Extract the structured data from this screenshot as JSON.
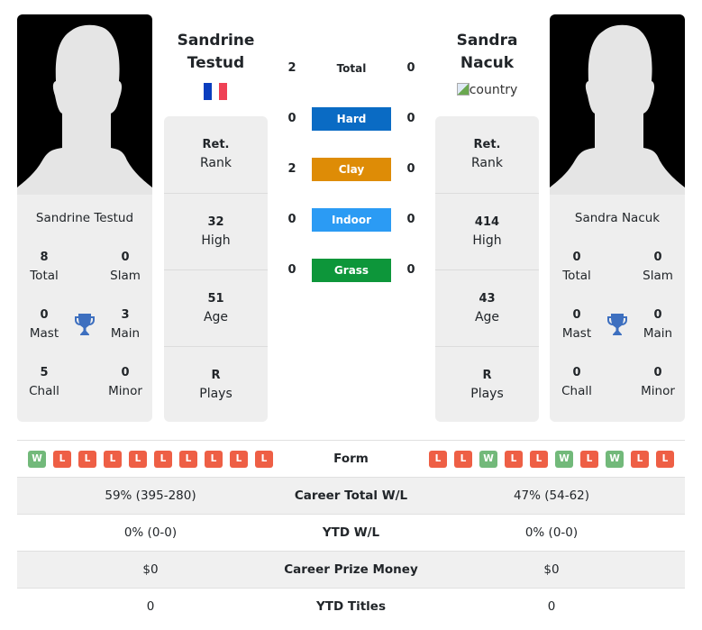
{
  "players": {
    "left": {
      "name_line1": "Sandrine",
      "name_line2": "Testud",
      "full_name": "Sandrine Testud",
      "country": "France",
      "flag_colors": [
        "#0a3ebf",
        "#ffffff",
        "#ef4155"
      ],
      "titles": {
        "total": {
          "value": "8",
          "label": "Total"
        },
        "slam": {
          "value": "0",
          "label": "Slam"
        },
        "mast": {
          "value": "0",
          "label": "Mast"
        },
        "main": {
          "value": "3",
          "label": "Main"
        },
        "chall": {
          "value": "5",
          "label": "Chall"
        },
        "minor": {
          "value": "0",
          "label": "Minor"
        }
      },
      "info": {
        "rank": {
          "value": "Ret.",
          "label": "Rank"
        },
        "high": {
          "value": "32",
          "label": "High"
        },
        "age": {
          "value": "51",
          "label": "Age"
        },
        "plays": {
          "value": "R",
          "label": "Plays"
        }
      },
      "form": [
        "W",
        "L",
        "L",
        "L",
        "L",
        "L",
        "L",
        "L",
        "L",
        "L"
      ],
      "career_total_wl": "59% (395-280)",
      "ytd_wl": "0% (0-0)",
      "career_prize_money": "$0",
      "ytd_titles": "0"
    },
    "right": {
      "name_line1": "Sandra",
      "name_line2": "Nacuk",
      "full_name": "Sandra Nacuk",
      "country_alt": "country",
      "titles": {
        "total": {
          "value": "0",
          "label": "Total"
        },
        "slam": {
          "value": "0",
          "label": "Slam"
        },
        "mast": {
          "value": "0",
          "label": "Mast"
        },
        "main": {
          "value": "0",
          "label": "Main"
        },
        "chall": {
          "value": "0",
          "label": "Chall"
        },
        "minor": {
          "value": "0",
          "label": "Minor"
        }
      },
      "info": {
        "rank": {
          "value": "Ret.",
          "label": "Rank"
        },
        "high": {
          "value": "414",
          "label": "High"
        },
        "age": {
          "value": "43",
          "label": "Age"
        },
        "plays": {
          "value": "R",
          "label": "Plays"
        }
      },
      "form": [
        "L",
        "L",
        "W",
        "L",
        "L",
        "W",
        "L",
        "W",
        "L",
        "L"
      ],
      "career_total_wl": "47% (54-62)",
      "ytd_wl": "0% (0-0)",
      "career_prize_money": "$0",
      "ytd_titles": "0"
    }
  },
  "h2h": [
    {
      "label": "Total",
      "left": "2",
      "right": "0",
      "color": ""
    },
    {
      "label": "Hard",
      "left": "0",
      "right": "0",
      "color": "#0a6bc4"
    },
    {
      "label": "Clay",
      "left": "2",
      "right": "0",
      "color": "#de8c06"
    },
    {
      "label": "Indoor",
      "left": "0",
      "right": "0",
      "color": "#2b9bf4"
    },
    {
      "label": "Grass",
      "left": "0",
      "right": "0",
      "color": "#0d963a"
    }
  ],
  "compare_labels": {
    "form": "Form",
    "career_total_wl": "Career Total W/L",
    "ytd_wl": "YTD W/L",
    "career_prize_money": "Career Prize Money",
    "ytd_titles": "YTD Titles"
  },
  "colors": {
    "win": "#72b97a",
    "loss": "#ee5f45",
    "trophy": "#3d6fbf",
    "card_bg": "#eeeeee"
  }
}
